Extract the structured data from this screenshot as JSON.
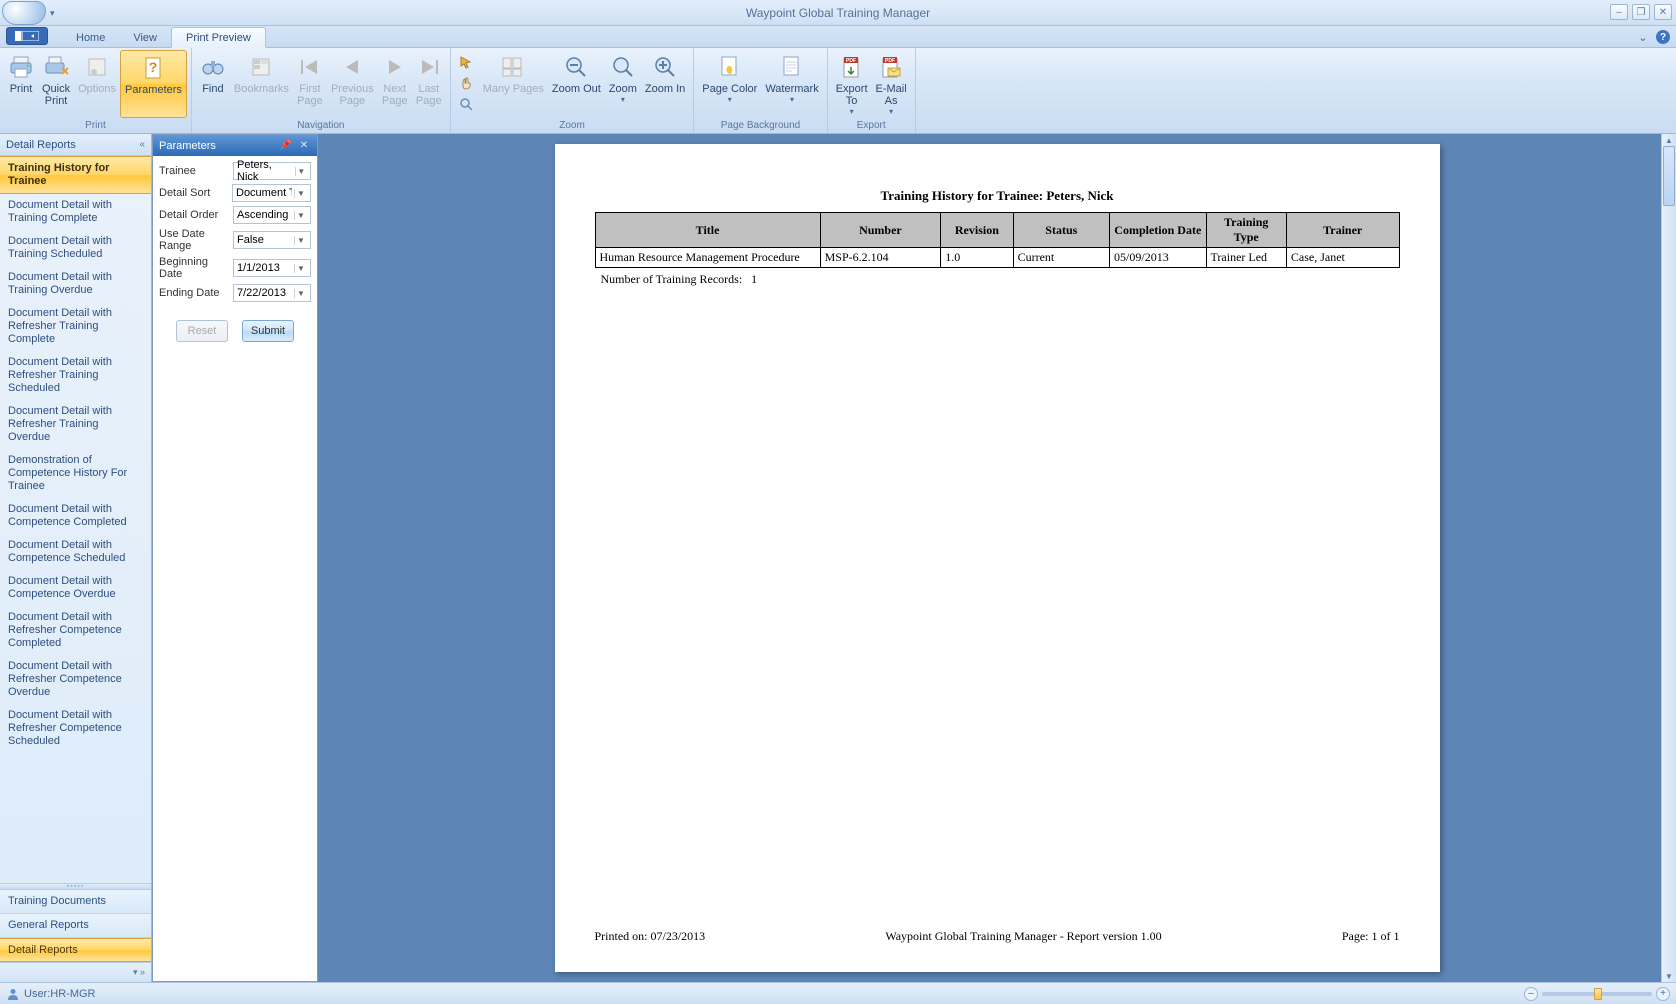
{
  "app_title": "Waypoint Global Training Manager",
  "tabs": {
    "home": "Home",
    "view": "View",
    "print_preview": "Print Preview"
  },
  "ribbon": {
    "print": {
      "print": "Print",
      "quick_print": "Quick\nPrint",
      "options": "Options",
      "parameters": "Parameters",
      "group": "Print"
    },
    "nav": {
      "find": "Find",
      "bookmarks": "Bookmarks",
      "first": "First\nPage",
      "prev": "Previous\nPage",
      "next": "Next\nPage",
      "last": "Last\nPage",
      "group": "Navigation"
    },
    "zoom": {
      "many": "Many Pages",
      "out": "Zoom Out",
      "zoom": "Zoom",
      "in": "Zoom In",
      "group": "Zoom"
    },
    "bg": {
      "color": "Page Color",
      "watermark": "Watermark",
      "group": "Page Background"
    },
    "export": {
      "export_to": "Export\nTo",
      "email_as": "E-Mail\nAs",
      "group": "Export"
    }
  },
  "leftnav": {
    "header": "Detail Reports",
    "items": [
      "Training History for Trainee",
      "Document Detail with Training Complete",
      "Document Detail with Training Scheduled",
      "Document Detail with Training Overdue",
      "Document Detail with Refresher Training Complete",
      "Document Detail with Refresher Training Scheduled",
      "Document Detail with Refresher Training Overdue",
      "Demonstration of Competence History For Trainee",
      "Document Detail with Competence Completed",
      "Document Detail with Competence Scheduled",
      "Document Detail with Competence Overdue",
      "Document Detail with Refresher Competence Completed",
      "Document Detail with Refresher Competence Overdue",
      "Document Detail with Refresher Competence Scheduled"
    ],
    "sections": {
      "training_docs": "Training Documents",
      "general": "General Reports",
      "detail": "Detail Reports"
    }
  },
  "params": {
    "title": "Parameters",
    "rows": {
      "trainee": {
        "label": "Trainee",
        "value": "Peters, Nick"
      },
      "sort": {
        "label": "Detail Sort",
        "value": "Document Title"
      },
      "order": {
        "label": "Detail Order",
        "value": "Ascending"
      },
      "range": {
        "label": "Use Date Range",
        "value": "False"
      },
      "begin": {
        "label": "Beginning Date",
        "value": "1/1/2013"
      },
      "end": {
        "label": "Ending Date",
        "value": "7/22/2013"
      }
    },
    "reset": "Reset",
    "submit": "Submit"
  },
  "report": {
    "title": "Training History for Trainee: Peters, Nick",
    "headers": [
      "Title",
      "Number",
      "Revision",
      "Status",
      "Completion Date",
      "Training Type",
      "Trainer"
    ],
    "rows": [
      [
        "Human Resource Management Procedure",
        "MSP-6.2.104",
        "1.0",
        "Current",
        "05/09/2013",
        "Trainer Led",
        "Case, Janet"
      ]
    ],
    "count_label": "Number of Training Records:",
    "count": "1",
    "printed_on": "Printed on:  07/23/2013",
    "footer_center": "Waypoint Global Training Manager - Report version 1.00",
    "footer_right": "Page: 1  of 1"
  },
  "status": {
    "user_label": "User:HR-MGR"
  }
}
